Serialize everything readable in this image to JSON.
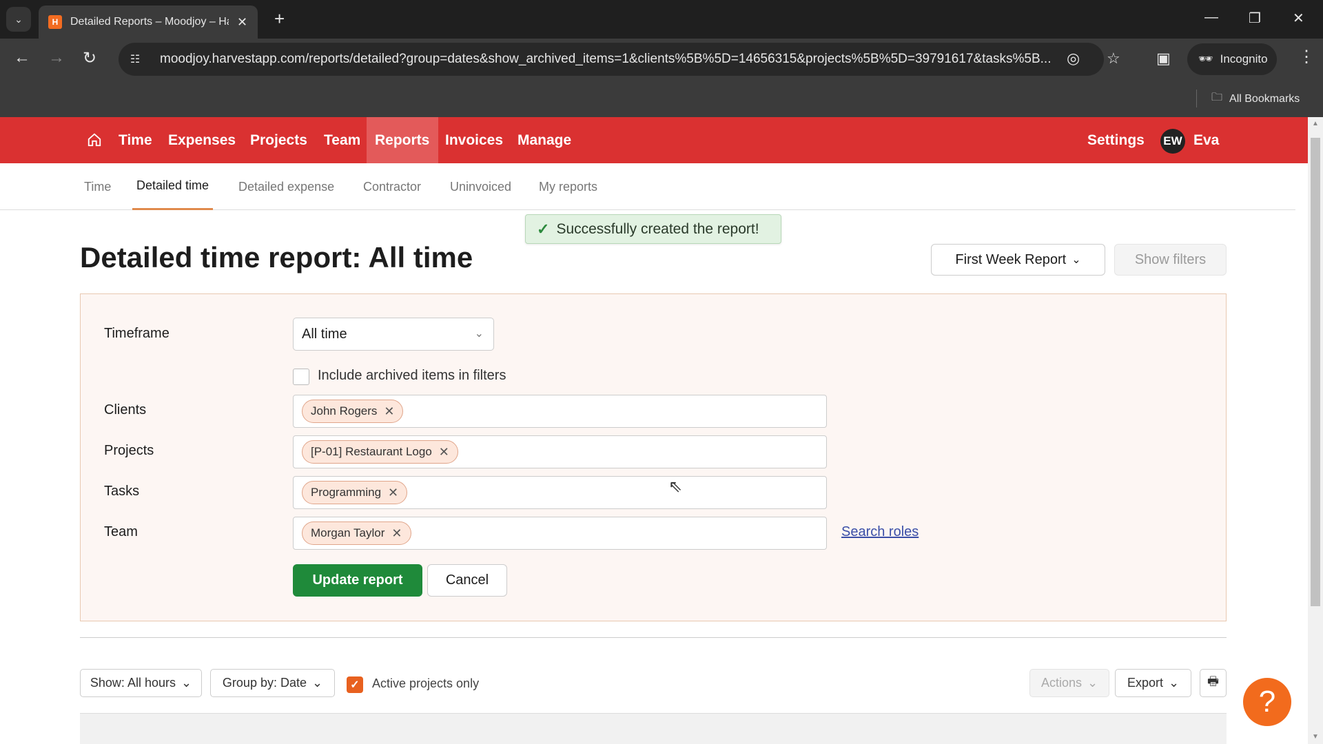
{
  "browser": {
    "tab_title": "Detailed Reports – Moodjoy – Harvest",
    "favicon_letter": "H",
    "url": "moodjoy.harvestapp.com/reports/detailed?group=dates&show_archived_items=1&clients%5B%5D=14656315&projects%5B%5D=39791617&tasks%5B...",
    "profile_label": "Incognito",
    "bookmarks_label": "All Bookmarks"
  },
  "nav": {
    "items": [
      "Time",
      "Expenses",
      "Projects",
      "Team",
      "Reports",
      "Invoices",
      "Manage"
    ],
    "active": "Reports",
    "settings": "Settings",
    "avatar_initials": "EW",
    "user_name": "Eva",
    "brand_color": "#da3131"
  },
  "subnav": {
    "items": [
      "Time",
      "Detailed time",
      "Detailed expense",
      "Contractor",
      "Uninvoiced",
      "My reports"
    ],
    "active": "Detailed time"
  },
  "toast": {
    "message": "Successfully created the report!"
  },
  "page": {
    "title": "Detailed time report: All time",
    "saved_report": "First Week Report",
    "show_filters": "Show filters"
  },
  "filters": {
    "timeframe_label": "Timeframe",
    "timeframe_value": "All time",
    "archived_label": "Include archived items in filters",
    "archived_checked": false,
    "clients_label": "Clients",
    "clients": [
      "John Rogers"
    ],
    "projects_label": "Projects",
    "projects": [
      "[P-01] Restaurant Logo"
    ],
    "tasks_label": "Tasks",
    "tasks": [
      "Programming"
    ],
    "team_label": "Team",
    "team": [
      "Morgan Taylor"
    ],
    "search_roles": "Search roles",
    "update_button": "Update report",
    "cancel_button": "Cancel"
  },
  "report_toolbar": {
    "show": "Show: All hours",
    "group_by": "Group by: Date",
    "active_projects_label": "Active projects only",
    "active_projects_checked": true,
    "actions": "Actions",
    "export": "Export"
  }
}
